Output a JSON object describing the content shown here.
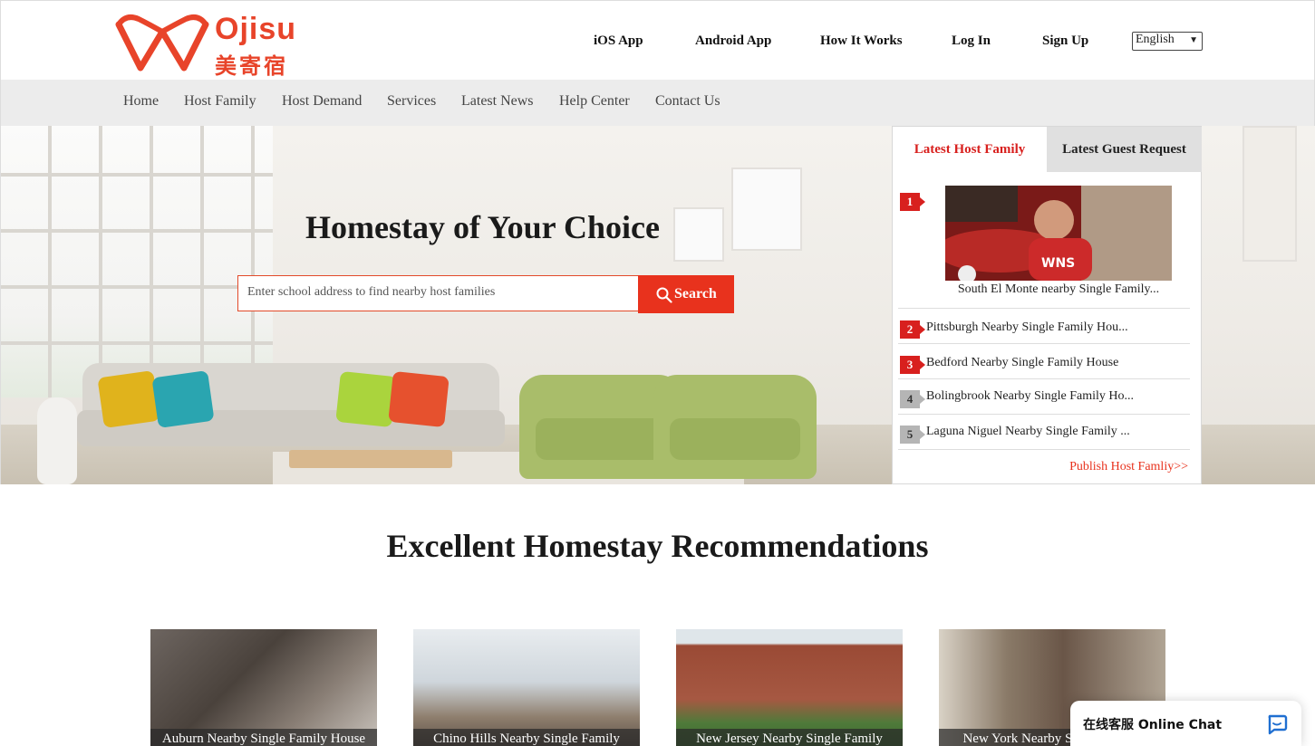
{
  "brand": {
    "name": "Ojisu",
    "name_cn": "美寄宿",
    "color": "#e8442a"
  },
  "topnav": {
    "items": [
      "iOS App",
      "Android App",
      "How It Works",
      "Log In",
      "Sign Up"
    ],
    "language": "English"
  },
  "mainnav": {
    "items": [
      "Home",
      "Host Family",
      "Host Demand",
      "Services",
      "Latest News",
      "Help Center",
      "Contact Us"
    ]
  },
  "hero": {
    "title": "Homestay of Your Choice",
    "search_placeholder": "Enter school address to find nearby host families",
    "search_button": "Search",
    "accent": "#e8321d"
  },
  "panel": {
    "tabs": [
      "Latest Host Family",
      "Latest Guest Request"
    ],
    "active_tab": "Latest Host Family",
    "items": [
      {
        "rank": "1",
        "title": "South El Monte nearby Single Family..."
      },
      {
        "rank": "2",
        "title": "Pittsburgh Nearby Single Family Hou..."
      },
      {
        "rank": "3",
        "title": "Bedford Nearby Single Family House"
      },
      {
        "rank": "4",
        "title": "Bolingbrook Nearby Single Family Ho..."
      },
      {
        "rank": "5",
        "title": "Laguna Niguel Nearby Single Family ..."
      }
    ],
    "publish_link": "Publish Host Famliy>>"
  },
  "recommendations": {
    "title": "Excellent Homestay Recommendations",
    "cards": [
      {
        "caption": "Auburn Nearby Single Family House"
      },
      {
        "caption": "Chino Hills Nearby Single Family"
      },
      {
        "caption": "New Jersey Nearby Single Family"
      },
      {
        "caption": "New York Nearby Single Family"
      }
    ]
  },
  "chat": {
    "label": "在线客服 Online Chat",
    "icon": "chat-bubble-icon"
  }
}
